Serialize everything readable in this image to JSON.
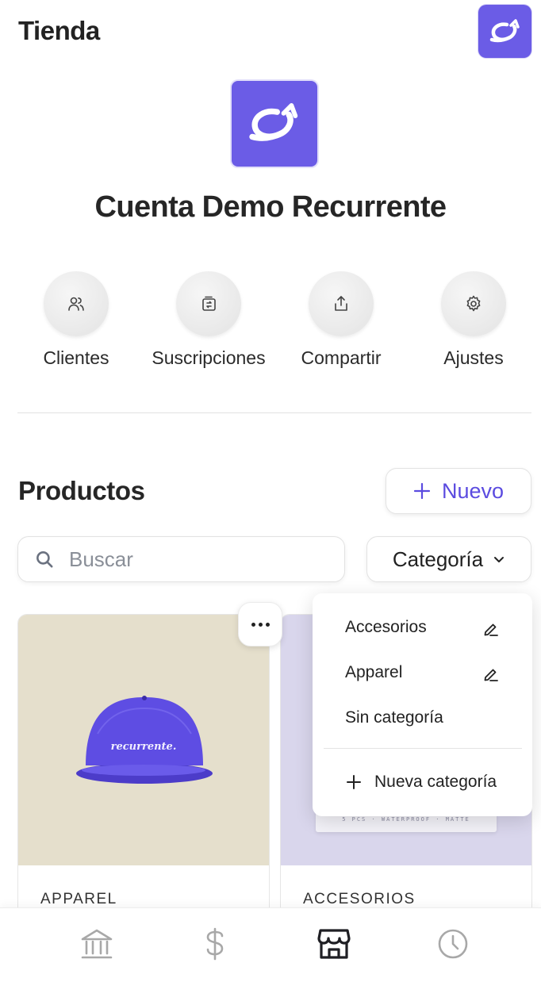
{
  "header": {
    "title": "Tienda"
  },
  "account": {
    "name": "Cuenta Demo Recurrente",
    "logo_color": "#6b5ce6"
  },
  "actions": [
    {
      "label": "Clientes",
      "icon": "users-icon"
    },
    {
      "label": "Suscripciones",
      "icon": "subscriptions-icon"
    },
    {
      "label": "Compartir",
      "icon": "share-icon"
    },
    {
      "label": "Ajustes",
      "icon": "gear-icon"
    }
  ],
  "products": {
    "title": "Productos",
    "new_label": "Nuevo",
    "search_placeholder": "Buscar",
    "category_label": "Categoría",
    "cards": [
      {
        "category": "APPAREL",
        "image_text": "recurrente."
      },
      {
        "category": "ACCESORIOS",
        "image_text": "5 PCS · WATERPROOF · MATTE"
      }
    ]
  },
  "category_menu": {
    "items": [
      {
        "label": "Accesorios",
        "editable": true
      },
      {
        "label": "Apparel",
        "editable": true
      },
      {
        "label": "Sin categoría",
        "editable": false
      }
    ],
    "new_label": "Nueva categoría"
  },
  "bottom_nav": [
    {
      "icon": "bank-icon",
      "active": false
    },
    {
      "icon": "dollar-icon",
      "active": false
    },
    {
      "icon": "store-icon",
      "active": true
    },
    {
      "icon": "clock-icon",
      "active": false
    }
  ],
  "colors": {
    "accent": "#5b4be0",
    "brand": "#6b5ce6",
    "inactive": "#a8a8a8"
  }
}
